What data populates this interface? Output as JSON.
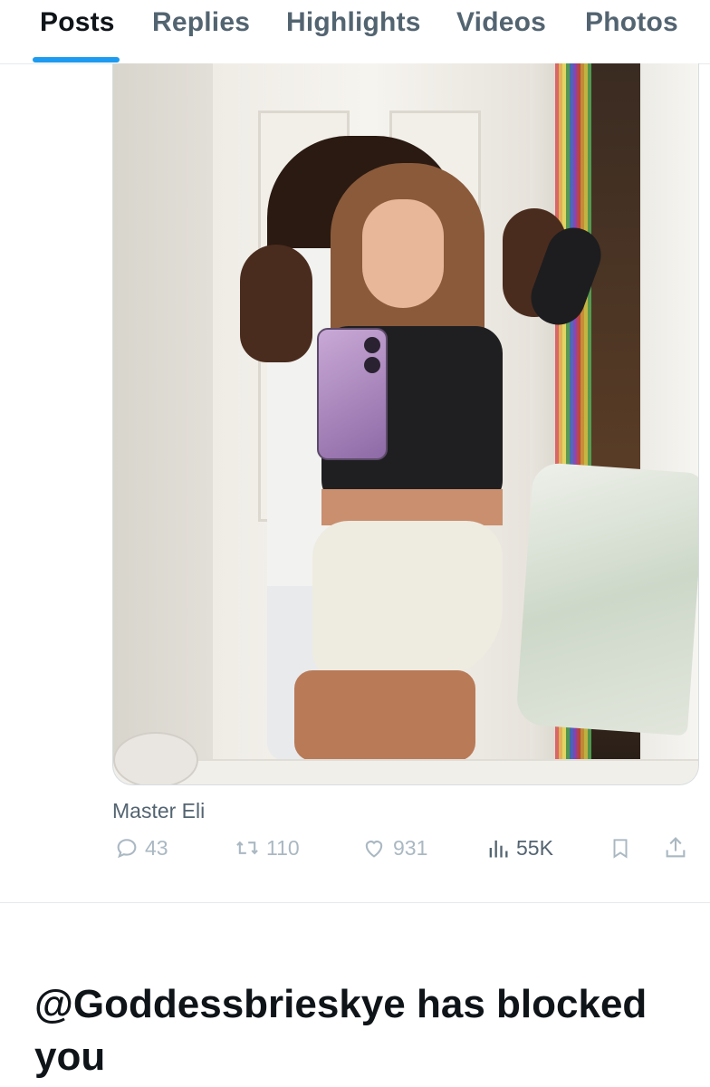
{
  "tabs": [
    {
      "label": "Posts",
      "active": true
    },
    {
      "label": "Replies",
      "active": false
    },
    {
      "label": "Highlights",
      "active": false
    },
    {
      "label": "Videos",
      "active": false
    },
    {
      "label": "Photos",
      "active": false
    }
  ],
  "post": {
    "author_caption": "Master Eli",
    "media_icon": "photo",
    "actions": {
      "replies": {
        "icon": "reply-icon",
        "count": "43"
      },
      "reposts": {
        "icon": "repost-icon",
        "count": "110"
      },
      "likes": {
        "icon": "heart-icon",
        "count": "931"
      },
      "views": {
        "icon": "views-icon",
        "count": "55K"
      },
      "bookmark": {
        "icon": "bookmark-icon"
      },
      "share": {
        "icon": "share-icon"
      }
    }
  },
  "blocked_message": "@Goddessbrieskye has blocked you",
  "colors": {
    "accent": "#1d9bf0",
    "text_primary": "#0f1419",
    "text_secondary": "#536471",
    "action_muted": "#aab8c2"
  }
}
